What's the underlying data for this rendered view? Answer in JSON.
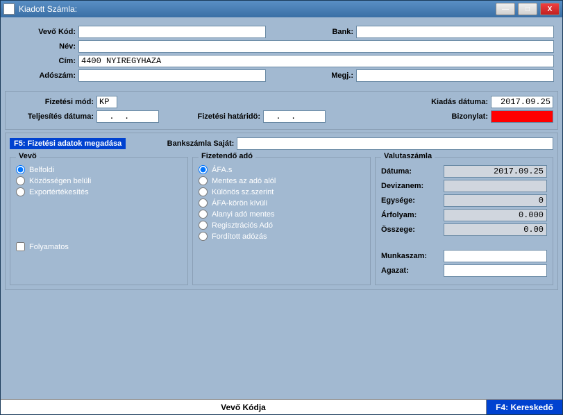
{
  "window": {
    "title": "Kiadott Számla:"
  },
  "win_buttons": {
    "min": "—",
    "max": "□",
    "close": "X"
  },
  "top": {
    "vevokod_label": "Vevő Kód:",
    "vevokod": "",
    "bank_label": "Bank:",
    "bank": "",
    "nev_label": "Név:",
    "nev": "",
    "cim_label": "Cím:",
    "cim": "4400 NYIREGYHAZA",
    "adoszam_label": "Adószám:",
    "adoszam": "",
    "megj_label": "Megj.:",
    "megj": ""
  },
  "pay": {
    "fizmod_label": "Fizetési mód:",
    "fizmod": "KP",
    "kiadas_label": "Kiadás dátuma:",
    "kiadas": "2017.09.25",
    "telj_label": "Teljesítés dátuma:",
    "telj": "  .  .  ",
    "fizhat_label": "Fizetési határidö:",
    "fizhat": "  .  .  ",
    "bizonylat_label": "Bizonylat:",
    "bizonylat": ""
  },
  "mid": {
    "f5": "F5: Fizetési adatok megadása",
    "banksz_label": "Bankszámla Saját:",
    "banksz": ""
  },
  "vevo": {
    "title": "Vevö",
    "r1": "Belfoldi",
    "r2": "Közösségen belüli",
    "r3": "Exportértékesítés",
    "chk": "Folyamatos"
  },
  "ado": {
    "title": "Fizetendő adó",
    "r1": "ÁFA.s",
    "r2": "Mentes az adó alól",
    "r3": "Különös sz.szerint",
    "r4": "ÁFA-körön kívüli",
    "r5": "Alanyi adó mentes",
    "r6": "Regisztrációs Adó",
    "r7": "Fordított adózás"
  },
  "valuta": {
    "title": "Valutaszámla",
    "datuma_label": "Dátuma:",
    "datuma": "2017.09.25",
    "deviza_label": "Devizanem:",
    "deviza": "",
    "egyseg_label": "Egysége:",
    "egyseg": "0",
    "arfolyam_label": "Árfolyam:",
    "arfolyam": "0.000",
    "osszeg_label": "Összege:",
    "osszeg": "0.00",
    "munka_label": "Munkaszam:",
    "munka": "",
    "agazat_label": "Agazat:",
    "agazat": ""
  },
  "status": {
    "left": "Vevő Kódja",
    "right": "F4: Kereskedő"
  }
}
